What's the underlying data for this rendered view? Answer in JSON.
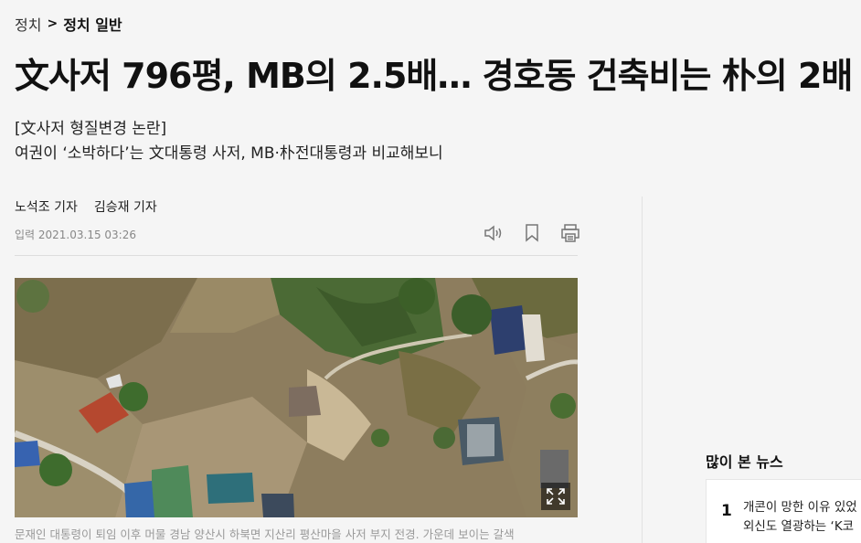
{
  "breadcrumb": {
    "section": "정치",
    "separator": ">",
    "subsection": "정치 일반"
  },
  "article": {
    "headline": "文사저 796평, MB의 2.5배… 경호동 건축비는 朴의 2배",
    "subtitle_1": "[文사저 형질변경 논란]",
    "subtitle_2": "여권이 ‘소박하다’는 文대통령 사저, MB·朴전대통령과 비교해보니",
    "reporter_1": "노석조 기자",
    "reporter_2": "김승재 기자",
    "published": "입력 2021.03.15 03:26",
    "caption": "문재인 대통령이 퇴임 이후 머물 경남 양산시 하북면 지산리 평산마을 사저 부지 전경. 가운데 보이는 갈색"
  },
  "tools": {
    "listen_icon": "speaker-icon",
    "bookmark_icon": "bookmark-icon",
    "print_icon": "print-icon"
  },
  "photo": {
    "expand_icon": "expand-icon"
  },
  "sidebar": {
    "popular_title": "많이 본 뉴스",
    "items": [
      {
        "rank": "1",
        "line_1": "개콘이 망한 이유 있었",
        "line_2": "외신도 열광하는 ‘K코"
      }
    ]
  }
}
